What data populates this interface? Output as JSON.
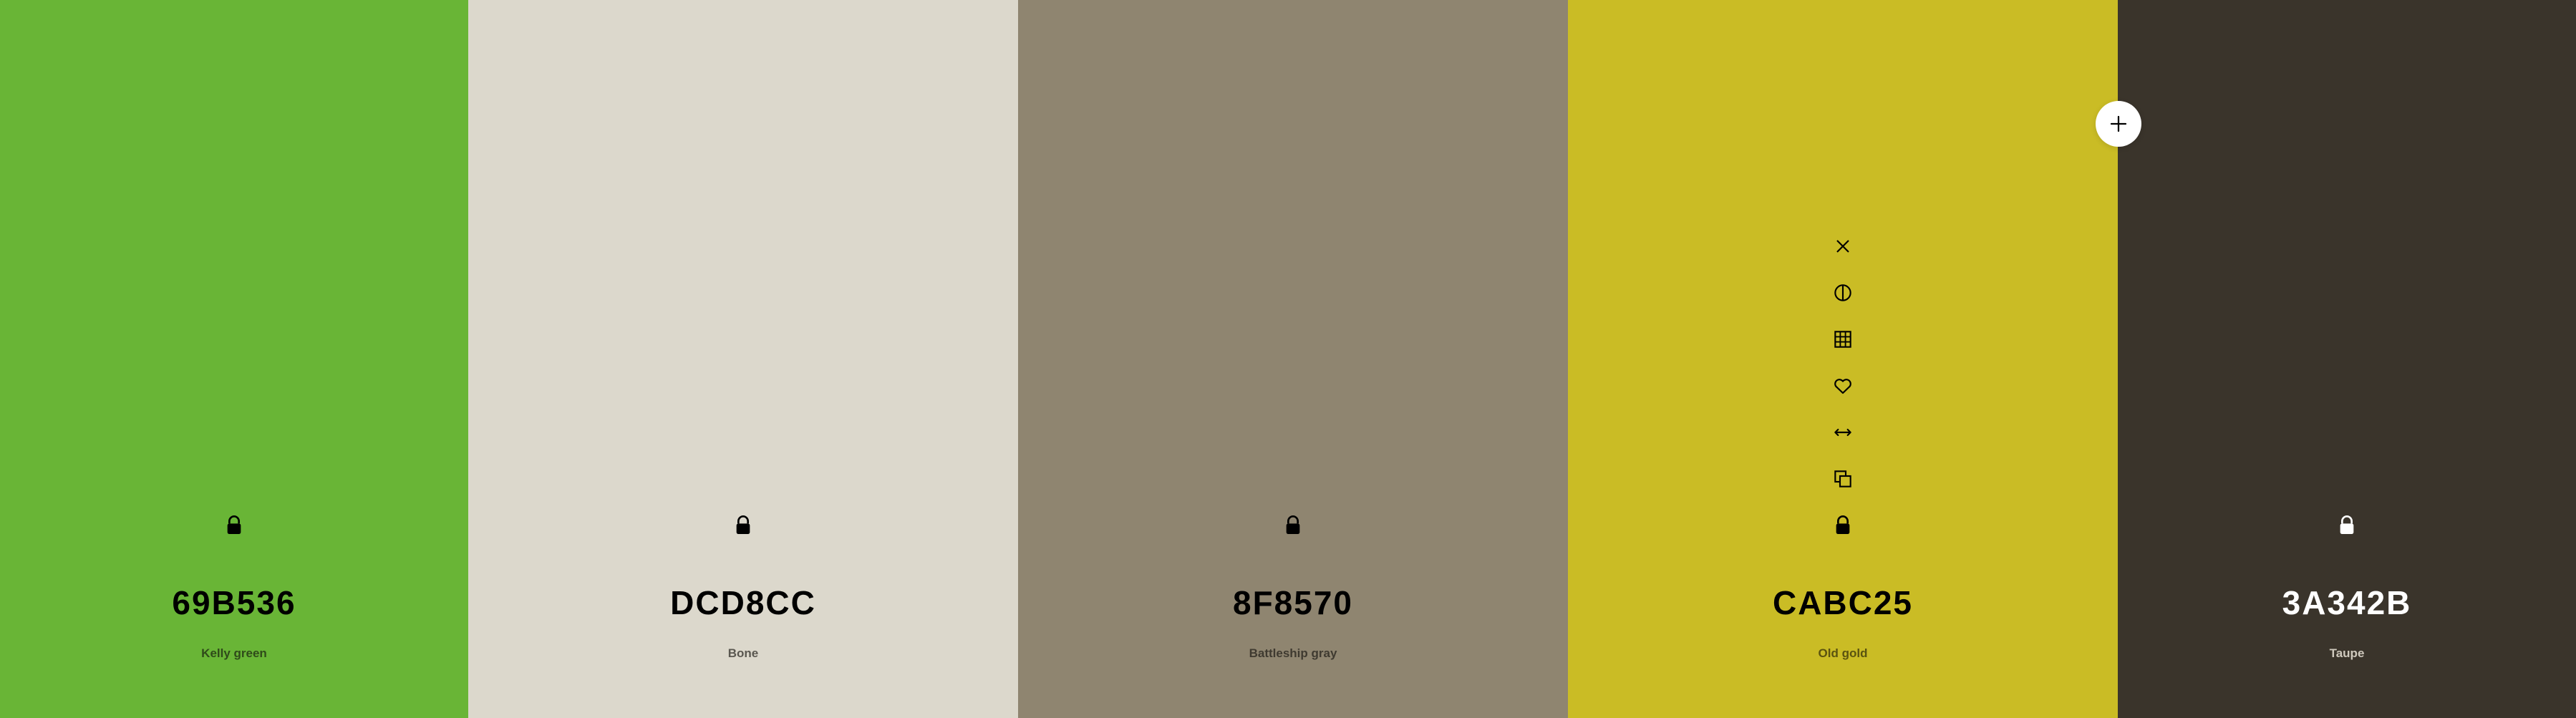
{
  "swatches": [
    {
      "hex": "69B536",
      "name": "Kelly green",
      "bg": "#69B536",
      "text": "#000000",
      "sub": "#2f4a1a",
      "locked": true,
      "icons": [
        "lock-icon"
      ]
    },
    {
      "hex": "DCD8CC",
      "name": "Bone",
      "bg": "#DCD8CC",
      "text": "#000000",
      "sub": "#5a5750",
      "locked": true,
      "icons": [
        "lock-icon"
      ]
    },
    {
      "hex": "8F8570",
      "name": "Battleship gray",
      "bg": "#8F8570",
      "text": "#000000",
      "sub": "#3f3a30",
      "locked": true,
      "icons": [
        "lock-icon"
      ]
    },
    {
      "hex": "CABC25",
      "name": "Old gold",
      "bg": "#CABC25",
      "text": "#000000",
      "sub": "#5a5310",
      "locked": true,
      "icons": [
        "remove-icon",
        "shades-icon",
        "grid-icon",
        "heart-icon",
        "drag-icon",
        "copy-icon",
        "lock-icon"
      ]
    },
    {
      "hex": "3A342B",
      "name": "Taupe",
      "bg": "#3A342B",
      "text": "#ffffff",
      "sub": "#cfc9bd",
      "locked": true,
      "icons": [
        "lock-icon"
      ]
    }
  ],
  "add_button": {
    "icon": "plus-icon"
  }
}
